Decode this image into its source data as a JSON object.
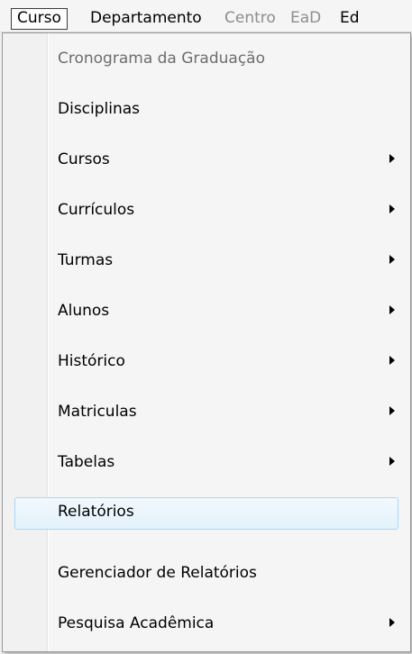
{
  "menubar": {
    "items": [
      {
        "label": "Curso",
        "state": "selected"
      },
      {
        "label": "Departamento",
        "state": "enabled"
      },
      {
        "label": "Centro",
        "state": "disabled"
      },
      {
        "label": "EaD",
        "state": "disabled"
      },
      {
        "label": "Ed",
        "state": "enabled"
      }
    ]
  },
  "dropdown": {
    "items": [
      {
        "label": "Cronograma da Graduação",
        "submenu": false,
        "enabled": false,
        "highlighted": false
      },
      {
        "label": "Disciplinas",
        "submenu": false,
        "enabled": true,
        "highlighted": false
      },
      {
        "label": "Cursos",
        "submenu": true,
        "enabled": true,
        "highlighted": false
      },
      {
        "label": "Currículos",
        "submenu": true,
        "enabled": true,
        "highlighted": false
      },
      {
        "label": "Turmas",
        "submenu": true,
        "enabled": true,
        "highlighted": false
      },
      {
        "label": "Alunos",
        "submenu": true,
        "enabled": true,
        "highlighted": false
      },
      {
        "label": "Histórico",
        "submenu": true,
        "enabled": true,
        "highlighted": false
      },
      {
        "label": "Matriculas",
        "submenu": true,
        "enabled": true,
        "highlighted": false
      },
      {
        "label": "Tabelas",
        "submenu": true,
        "enabled": true,
        "highlighted": false
      },
      {
        "label": "Relatórios",
        "submenu": false,
        "enabled": true,
        "highlighted": true
      },
      {
        "label": "Gerenciador de Relatórios",
        "submenu": false,
        "enabled": true,
        "highlighted": false
      },
      {
        "label": "Pesquisa Acadêmica",
        "submenu": true,
        "enabled": true,
        "highlighted": false
      }
    ]
  },
  "colors": {
    "highlight_border": "#a8d8f5",
    "highlight_fill": "#e3f2fc",
    "disabled_text": "#8d8d8d"
  }
}
